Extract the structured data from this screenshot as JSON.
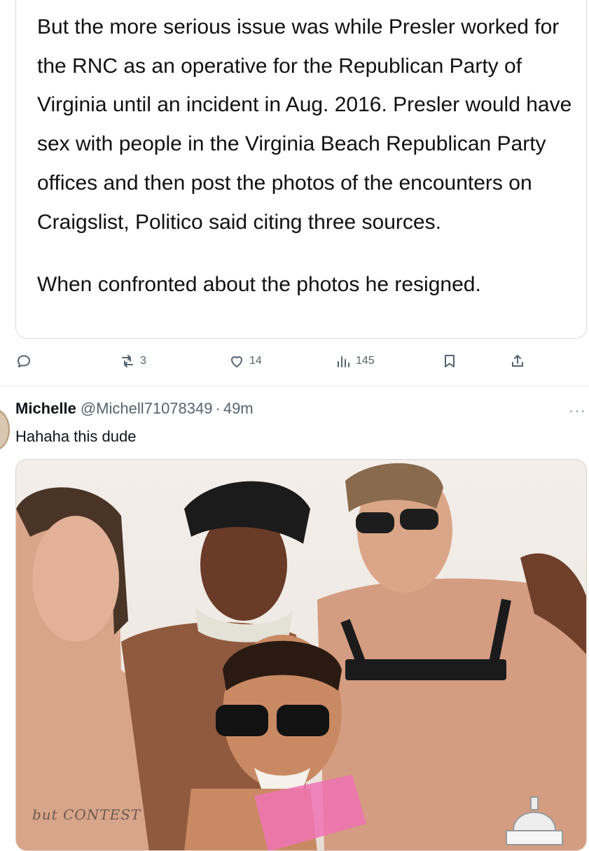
{
  "quoted_post": {
    "paragraph_1": "But the more serious issue was while Presler worked for the RNC as an operative for the Republican Party of Virginia until an incident in Aug. 2016. Presler would have sex with people in the Virginia Beach Republican Party offices and then post the photos of the encounters on Craigslist, Politico said citing three sources.",
    "paragraph_2": "When confronted about the photos he resigned."
  },
  "actions": {
    "reply_icon": "comment-icon",
    "retweet_icon": "retweet-icon",
    "retweet_count": "3",
    "like_icon": "heart-icon",
    "like_count": "14",
    "views_icon": "views-chart-icon",
    "views_count": "145",
    "bookmark_icon": "bookmark-icon",
    "share_icon": "share-icon"
  },
  "reply": {
    "name": "Michelle",
    "handle": "@Michell71078349",
    "separator": "·",
    "time": "49m",
    "more": "···",
    "text": "Hahaha this dude"
  },
  "photo": {
    "watermark": "but CONTEST"
  },
  "colors": {
    "text": "#0f1419",
    "muted": "#536471",
    "border": "#d6dbe0"
  }
}
